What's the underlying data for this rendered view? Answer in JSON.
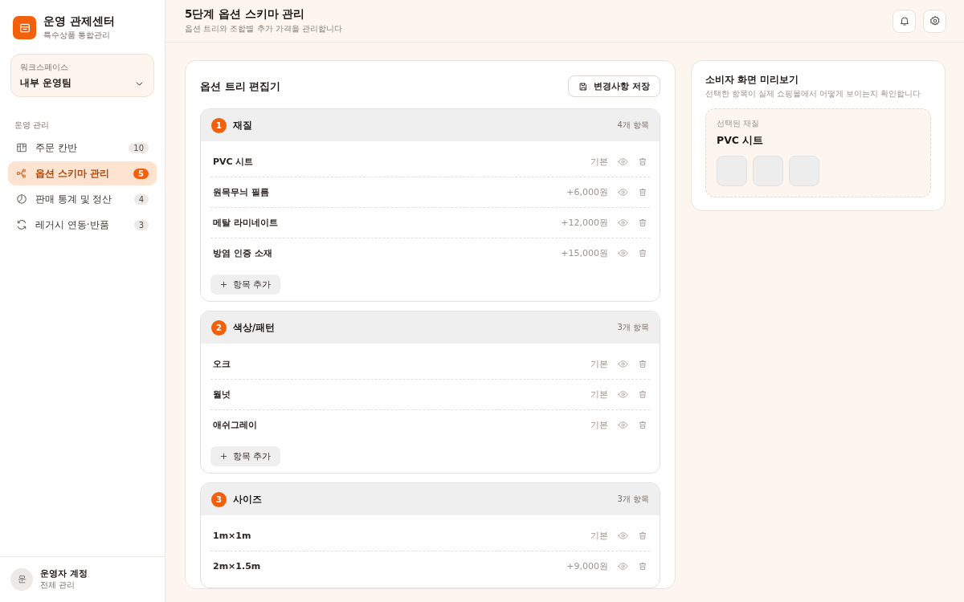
{
  "brand": {
    "title": "운영 관제센터",
    "subtitle": "특수상품 통합관리"
  },
  "workspace": {
    "label": "워크스페이스",
    "value": "내부 운영팀"
  },
  "nav_section": "운영 관리",
  "nav": [
    {
      "kind": "kanban",
      "label": "주문 칸반",
      "count": "10",
      "selected": false
    },
    {
      "kind": "tree",
      "label": "옵션 스키마 관리",
      "count": "5",
      "selected": true
    },
    {
      "kind": "chart",
      "label": "판매 통계 및 정산",
      "count": "4",
      "selected": false
    },
    {
      "kind": "sync",
      "label": "레거시 연동·반품",
      "count": "3",
      "selected": false
    }
  ],
  "account": {
    "avatar": "운",
    "name": "운영자 계정",
    "role": "전체 관리"
  },
  "header": {
    "title": "5단계 옵션 스키마 관리",
    "subtitle": "옵션 트리와 조합별 추가 가격을 관리합니다"
  },
  "editor": {
    "title": "옵션 트리 편집기",
    "save_button": "변경사항 저장",
    "groups": [
      {
        "number": "1",
        "name": "재질",
        "count": "4개 항목",
        "add_button": "항목 추가",
        "items": [
          {
            "name": "PVC 시트",
            "price": "기본"
          },
          {
            "name": "원목무늬 필름",
            "price": "+6,000원"
          },
          {
            "name": "메탈 라미네이트",
            "price": "+12,000원"
          },
          {
            "name": "방염 인증 소재",
            "price": "+15,000원"
          }
        ]
      },
      {
        "number": "2",
        "name": "색상/패턴",
        "count": "3개 항목",
        "add_button": "항목 추가",
        "items": [
          {
            "name": "오크",
            "price": "기본"
          },
          {
            "name": "월넛",
            "price": "기본"
          },
          {
            "name": "애쉬그레이",
            "price": "기본"
          }
        ]
      },
      {
        "number": "3",
        "name": "사이즈",
        "count": "3개 항목",
        "items": [
          {
            "name": "1m×1m",
            "price": "기본"
          },
          {
            "name": "2m×1.5m",
            "price": "+9,000원"
          }
        ]
      }
    ]
  },
  "preview": {
    "title": "소비자 화면 미리보기",
    "subtitle": "선택한 항목이 실제 쇼핑몰에서 어떻게 보이는지 확인합니다",
    "selected_label": "선택된 재질",
    "selected_value": "PVC 시트"
  }
}
